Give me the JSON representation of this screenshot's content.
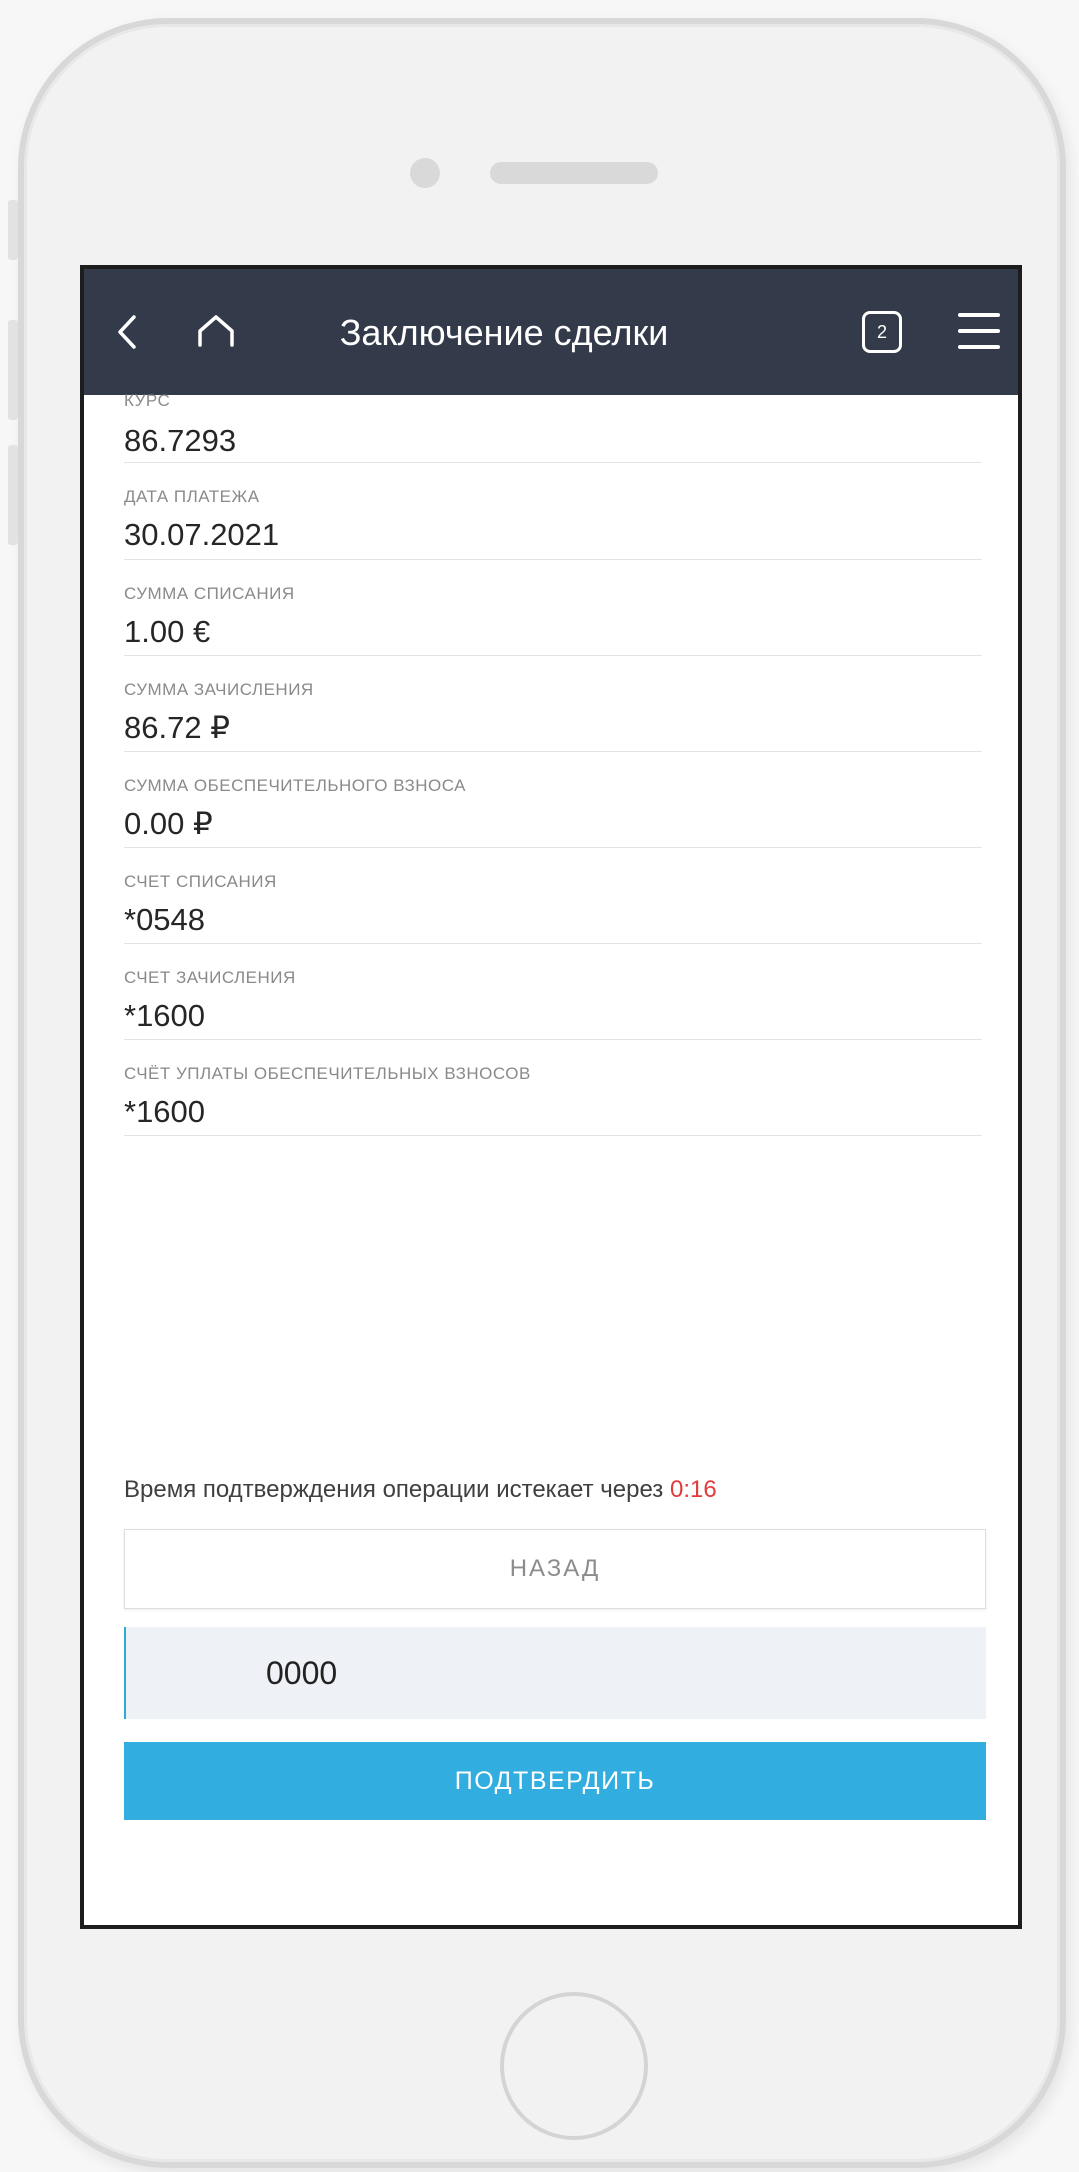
{
  "header": {
    "title": "Заключение сделки",
    "badge_count": "2",
    "back_icon": "chevron-left",
    "home_icon": "home",
    "menu_icon": "hamburger-menu"
  },
  "fields": [
    {
      "label": "КУРС",
      "value": "86.7293"
    },
    {
      "label": "ДАТА ПЛАТЕЖА",
      "value": "30.07.2021"
    },
    {
      "label": "СУММА СПИСАНИЯ",
      "value": "1.00 €"
    },
    {
      "label": "СУММА ЗАЧИСЛЕНИЯ",
      "value": "86.72 ₽"
    },
    {
      "label": "СУММА ОБЕСПЕЧИТЕЛЬНОГО ВЗНОСА",
      "value": "0.00 ₽"
    },
    {
      "label": "СЧЕТ СПИСАНИЯ",
      "value": "*0548"
    },
    {
      "label": "СЧЕТ ЗАЧИСЛЕНИЯ",
      "value": "*1600"
    },
    {
      "label": "СЧЁТ УПЛАТЫ ОБЕСПЕЧИТЕЛЬНЫХ ВЗНОСОВ",
      "value": "*1600"
    }
  ],
  "timer": {
    "text": "Время подтверждения операции истекает через",
    "countdown": "0:16"
  },
  "actions": {
    "back_label": "НАЗАД",
    "code_value": "0000",
    "confirm_label": "ПОДТВЕРДИТЬ"
  },
  "colors": {
    "header_bg": "#333b4a",
    "accent": "#31aedf",
    "countdown": "#e23b3b"
  }
}
